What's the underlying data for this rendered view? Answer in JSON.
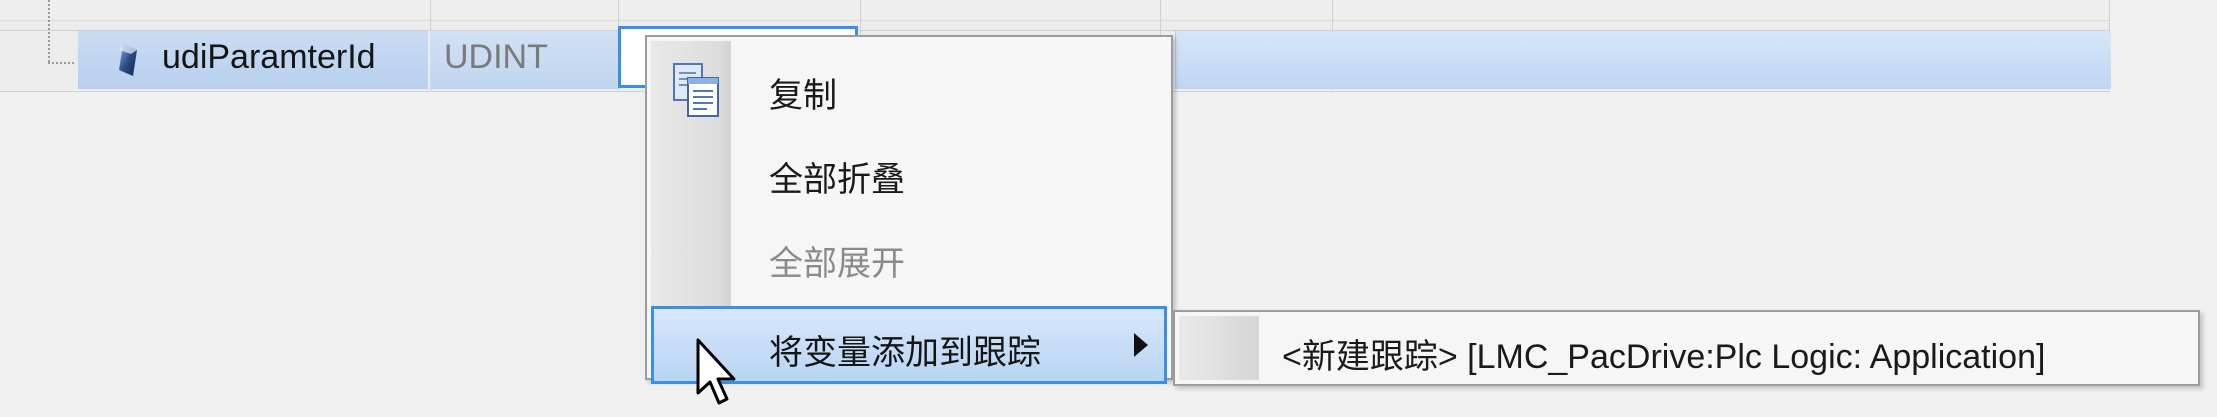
{
  "grid": {
    "row": {
      "name": "udiParamterId",
      "type": "UDINT",
      "icon": "variable-icon"
    }
  },
  "context_menu": {
    "items": [
      {
        "label": "复制",
        "icon": "copy-icon",
        "enabled": true
      },
      {
        "label": "全部折叠",
        "enabled": true
      },
      {
        "label": "全部展开",
        "enabled": false
      },
      {
        "label": "将变量添加到跟踪",
        "enabled": true,
        "has_submenu": true,
        "highlighted": true
      }
    ]
  },
  "submenu": {
    "items": [
      {
        "label": "<新建跟踪> [LMC_PacDrive:Plc Logic: Application]"
      }
    ]
  },
  "colors": {
    "selection_blue": "#3d8fe6",
    "row_highlight": "#c9dcf3",
    "disabled_text": "#8a8a8a"
  },
  "cursor": "arrow-pointer-icon"
}
